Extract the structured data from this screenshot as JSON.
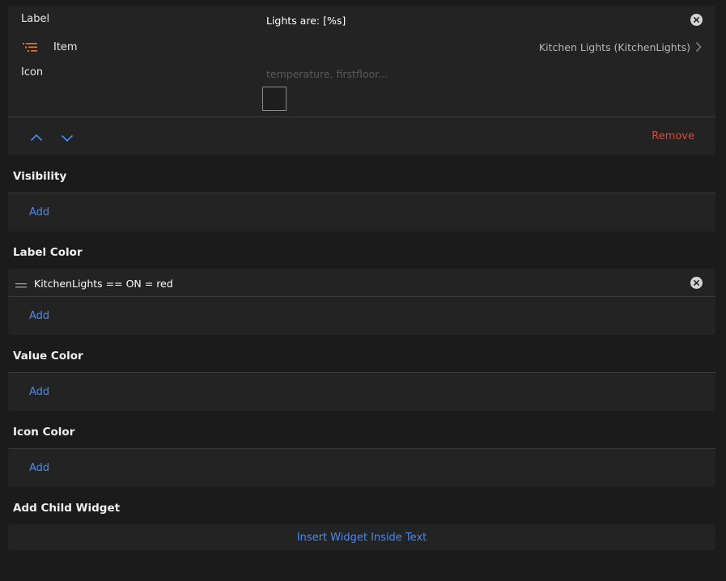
{
  "widget": {
    "label_field": "Label",
    "label_value": "Lights are: [%s]",
    "item_field": "Item",
    "item_value": "Kitchen Lights (KitchenLights)",
    "icon_field": "Icon",
    "icon_placeholder": "temperature, firstfloor...",
    "remove_label": "Remove"
  },
  "sections": {
    "visibility": {
      "title": "Visibility",
      "add_label": "Add"
    },
    "label_color": {
      "title": "Label Color",
      "rules": [
        "KitchenLights == ON = red"
      ],
      "add_label": "Add"
    },
    "value_color": {
      "title": "Value Color",
      "add_label": "Add"
    },
    "icon_color": {
      "title": "Icon Color",
      "add_label": "Add"
    },
    "child_widget": {
      "title": "Add Child Widget",
      "insert_label": "Insert Widget Inside Text"
    }
  },
  "colors": {
    "accent": "#4a8bf0",
    "danger": "#e5452f",
    "item_icon": "#e8772e"
  },
  "icons": {
    "item": "list-icon",
    "chevron": "chevron-right-icon",
    "clear": "close-circle-icon",
    "move_up": "chevron-up-icon",
    "move_down": "chevron-down-icon",
    "drag": "drag-handle-icon"
  }
}
